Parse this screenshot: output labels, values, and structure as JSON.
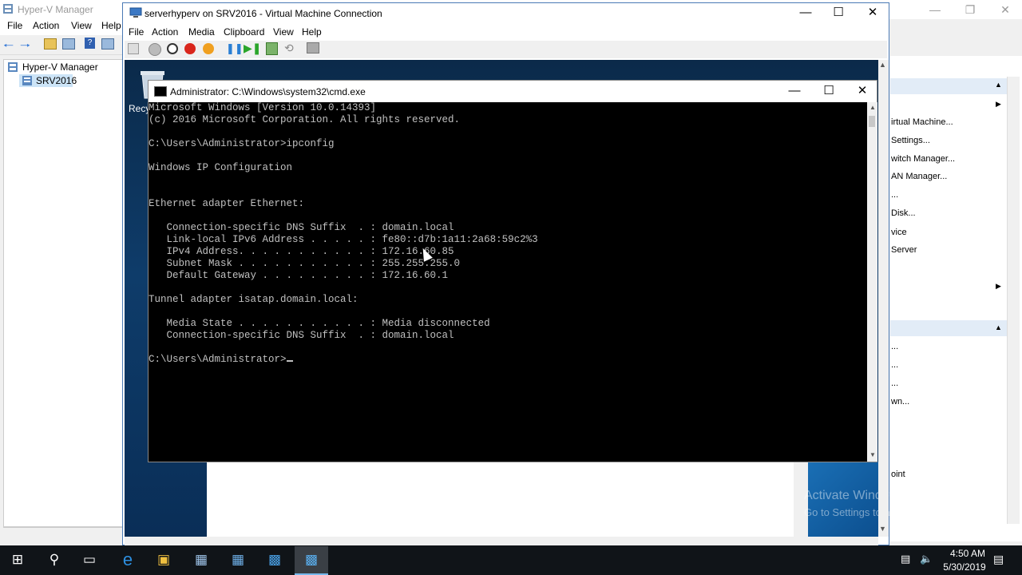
{
  "hyperv": {
    "title": "Hyper-V Manager",
    "menu": [
      "File",
      "Action",
      "View",
      "Help"
    ],
    "tree": {
      "root": "Hyper-V Manager",
      "server": "SRV2016"
    },
    "actions": [
      "irtual Machine...",
      "Settings...",
      "witch Manager...",
      "AN Manager...",
      "...",
      "Disk...",
      "vice",
      "Server",
      "...",
      "...",
      "...",
      "wn...",
      "oint"
    ]
  },
  "vm": {
    "title": "serverhyperv on SRV2016 - Virtual Machine Connection",
    "menu": [
      "File",
      "Action",
      "Media",
      "Clipboard",
      "View",
      "Help"
    ],
    "desktop": {
      "recycle_label": "Recy"
    },
    "watermark": {
      "line1": "Activate Windows",
      "line2": "Go to Settings to activate Windows."
    }
  },
  "cmd": {
    "title": "Administrator: C:\\Windows\\system32\\cmd.exe",
    "lines": [
      "Microsoft Windows [Version 10.0.14393]",
      "(c) 2016 Microsoft Corporation. All rights reserved.",
      "",
      "C:\\Users\\Administrator>ipconfig",
      "",
      "Windows IP Configuration",
      "",
      "",
      "Ethernet adapter Ethernet:",
      "",
      "   Connection-specific DNS Suffix  . : domain.local",
      "   Link-local IPv6 Address . . . . . : fe80::d7b:1a11:2a68:59c2%3",
      "   IPv4 Address. . . . . . . . . . . : 172.16.60.85",
      "   Subnet Mask . . . . . . . . . . . : 255.255.255.0",
      "   Default Gateway . . . . . . . . . : 172.16.60.1",
      "",
      "Tunnel adapter isatap.domain.local:",
      "",
      "   Media State . . . . . . . . . . . : Media disconnected",
      "   Connection-specific DNS Suffix  . : domain.local",
      "",
      "C:\\Users\\Administrator>"
    ]
  },
  "taskbar": {
    "time": "4:50 AM",
    "date": "5/30/2019"
  },
  "colors": {
    "cmd_bg": "#000000",
    "cmd_fg": "#c0c0c0",
    "taskbar": "#101418",
    "accent": "#76b9ed"
  }
}
